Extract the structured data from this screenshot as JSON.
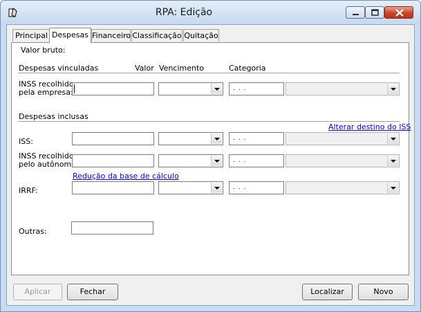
{
  "window": {
    "title": "RPA: Edição"
  },
  "tabs": [
    "Principal",
    "Despesas",
    "Financeiro",
    "Classificação",
    "Quitação"
  ],
  "active_tab": "Despesas",
  "labels": {
    "valor_bruto": "Valor bruto:",
    "despesas_vinculadas": "Despesas vinculadas",
    "col_valor": "Valor",
    "col_vencimento": "Vencimento",
    "col_categoria": "Categoria",
    "inss_empresa_1": "INSS recolhido",
    "inss_empresa_2": "pela empresa:",
    "despesas_inclusas": "Despesas inclusas",
    "iss": "ISS:",
    "inss_autonomo_1": "INSS recolhido",
    "inss_autonomo_2": "pelo autônomo:",
    "irrf": "IRRF:",
    "outras": "Outras:"
  },
  "links": {
    "alterar_destino_iss": "Alterar destino do ISS",
    "reducao_base": "Redução da base de cálculo"
  },
  "date_mask": ". . .",
  "buttons": {
    "aplicar": "Aplicar",
    "fechar": "Fechar",
    "localizar": "Localizar",
    "novo": "Novo"
  }
}
